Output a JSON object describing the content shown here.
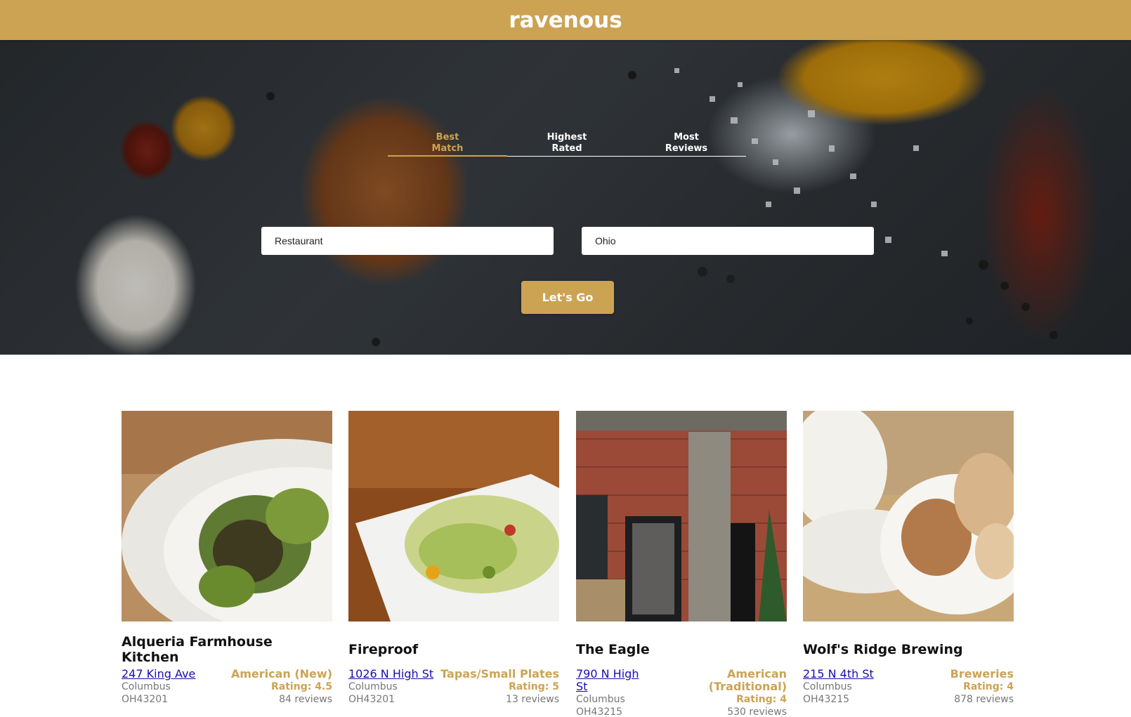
{
  "header": {
    "logo": "ravenous"
  },
  "search": {
    "sort_tabs": [
      {
        "label": "Best\nMatch",
        "active": true
      },
      {
        "label": "Highest\nRated",
        "active": false
      },
      {
        "label": "Most\nReviews",
        "active": false
      }
    ],
    "term_value": "Restaurant",
    "location_value": "Ohio",
    "submit_label": "Let's Go"
  },
  "businesses": [
    {
      "name": "Alqueria Farmhouse Kitchen",
      "street": "247 King Ave",
      "city": "Columbus",
      "zip": "OH43201",
      "category": "American (New)",
      "rating": "Rating: 4.5",
      "reviews": "84 reviews"
    },
    {
      "name": "Fireproof",
      "street": "1026 N High St",
      "city": "Columbus",
      "zip": "OH43201",
      "category": "Tapas/Small Plates",
      "rating": "Rating: 5",
      "reviews": "13 reviews"
    },
    {
      "name": "The Eagle",
      "street": "790 N High St",
      "city": "Columbus",
      "zip": "OH43215",
      "category": "American (Traditional)",
      "rating": "Rating: 4",
      "reviews": "530 reviews"
    },
    {
      "name": "Wolf's Ridge Brewing",
      "street": "215 N 4th St",
      "city": "Columbus",
      "zip": "OH43215",
      "category": "Breweries",
      "rating": "Rating: 4",
      "reviews": "878 reviews"
    }
  ],
  "colors": {
    "brand": "#CCA353",
    "link": "#1a0dab"
  }
}
